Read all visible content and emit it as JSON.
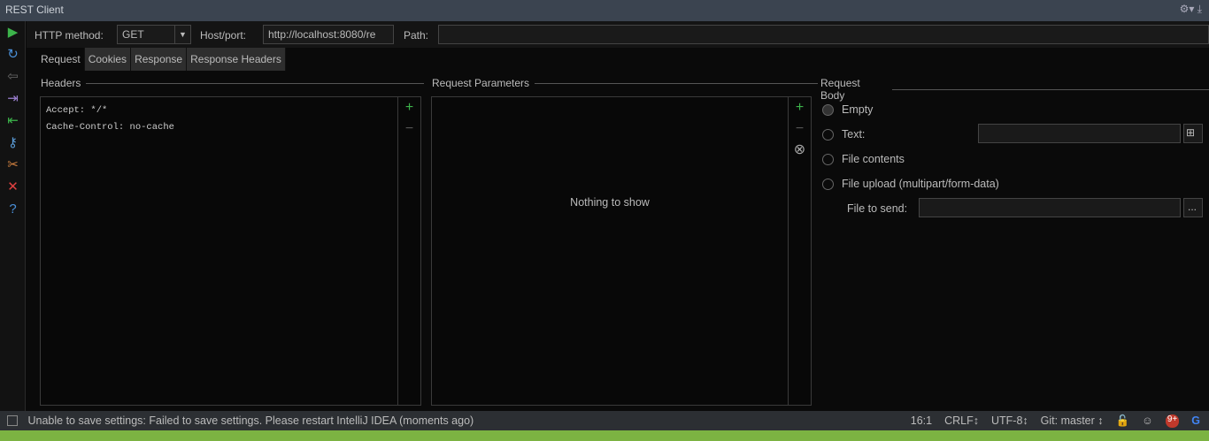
{
  "title": "REST Client",
  "toolbar": {
    "method_label": "HTTP method:",
    "method_value": "GET",
    "host_label": "Host/port:",
    "host_value": "http://localhost:8080/re",
    "path_label": "Path:",
    "path_value": ""
  },
  "tabs": [
    "Request",
    "Cookies",
    "Response",
    "Response Headers"
  ],
  "headers": {
    "title": "Headers",
    "lines": [
      "Accept: */*",
      "Cache-Control: no-cache"
    ]
  },
  "params": {
    "title": "Request Parameters",
    "empty": "Nothing to show"
  },
  "body": {
    "title": "Request Body",
    "options": [
      "Empty",
      "Text:",
      "File contents",
      "File upload (multipart/form-data)"
    ],
    "file_label": "File to send:",
    "browse": "..."
  },
  "status": {
    "message": "Unable to save settings: Failed to save settings. Please restart IntelliJ IDEA (moments ago)",
    "position": "16:1",
    "line_sep": "CRLF↕",
    "encoding": "UTF-8↕",
    "git": "Git: master ↕",
    "notifications": "9+"
  }
}
